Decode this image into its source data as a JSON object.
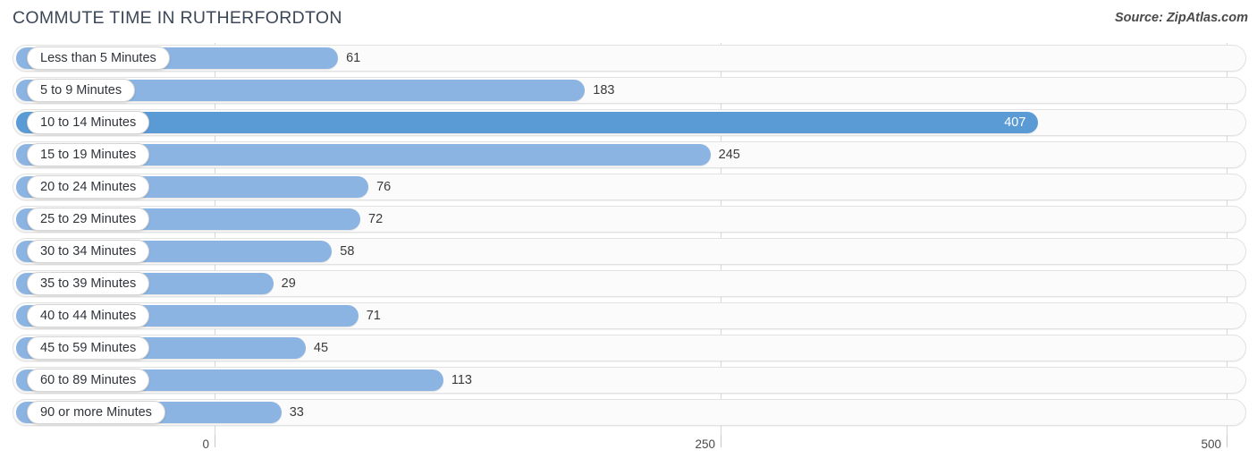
{
  "header": {
    "title": "COMMUTE TIME IN RUTHERFORDTON",
    "source": "Source: ZipAtlas.com"
  },
  "colors": {
    "bar": "#8cb4e2",
    "bar_highlight": "#5b9bd5",
    "track": "#fbfbfb",
    "gridline": "#d8d8d8",
    "text": "#333333"
  },
  "chart_data": {
    "type": "bar",
    "orientation": "horizontal",
    "title": "COMMUTE TIME IN RUTHERFORDTON",
    "xlabel": "",
    "ylabel": "",
    "xlim": [
      0,
      500
    ],
    "ticks": [
      "0",
      "250",
      "500"
    ],
    "tick_values": [
      0,
      250,
      500
    ],
    "grid": true,
    "legend": null,
    "categories": [
      "Less than 5 Minutes",
      "5 to 9 Minutes",
      "10 to 14 Minutes",
      "15 to 19 Minutes",
      "20 to 24 Minutes",
      "25 to 29 Minutes",
      "30 to 34 Minutes",
      "35 to 39 Minutes",
      "40 to 44 Minutes",
      "45 to 59 Minutes",
      "60 to 89 Minutes",
      "90 or more Minutes"
    ],
    "values": [
      61,
      183,
      407,
      245,
      76,
      72,
      58,
      29,
      71,
      45,
      113,
      33
    ],
    "highlight_index": 2,
    "rows": [
      {
        "label": "Less than 5 Minutes",
        "value": 61,
        "value_text": "61",
        "highlight": false
      },
      {
        "label": "5 to 9 Minutes",
        "value": 183,
        "value_text": "183",
        "highlight": false
      },
      {
        "label": "10 to 14 Minutes",
        "value": 407,
        "value_text": "407",
        "highlight": true
      },
      {
        "label": "15 to 19 Minutes",
        "value": 245,
        "value_text": "245",
        "highlight": false
      },
      {
        "label": "20 to 24 Minutes",
        "value": 76,
        "value_text": "76",
        "highlight": false
      },
      {
        "label": "25 to 29 Minutes",
        "value": 72,
        "value_text": "72",
        "highlight": false
      },
      {
        "label": "30 to 34 Minutes",
        "value": 58,
        "value_text": "58",
        "highlight": false
      },
      {
        "label": "35 to 39 Minutes",
        "value": 29,
        "value_text": "29",
        "highlight": false
      },
      {
        "label": "40 to 44 Minutes",
        "value": 71,
        "value_text": "71",
        "highlight": false
      },
      {
        "label": "45 to 59 Minutes",
        "value": 45,
        "value_text": "45",
        "highlight": false
      },
      {
        "label": "60 to 89 Minutes",
        "value": 113,
        "value_text": "113",
        "highlight": false
      },
      {
        "label": "90 or more Minutes",
        "value": 33,
        "value_text": "33",
        "highlight": false
      }
    ]
  }
}
